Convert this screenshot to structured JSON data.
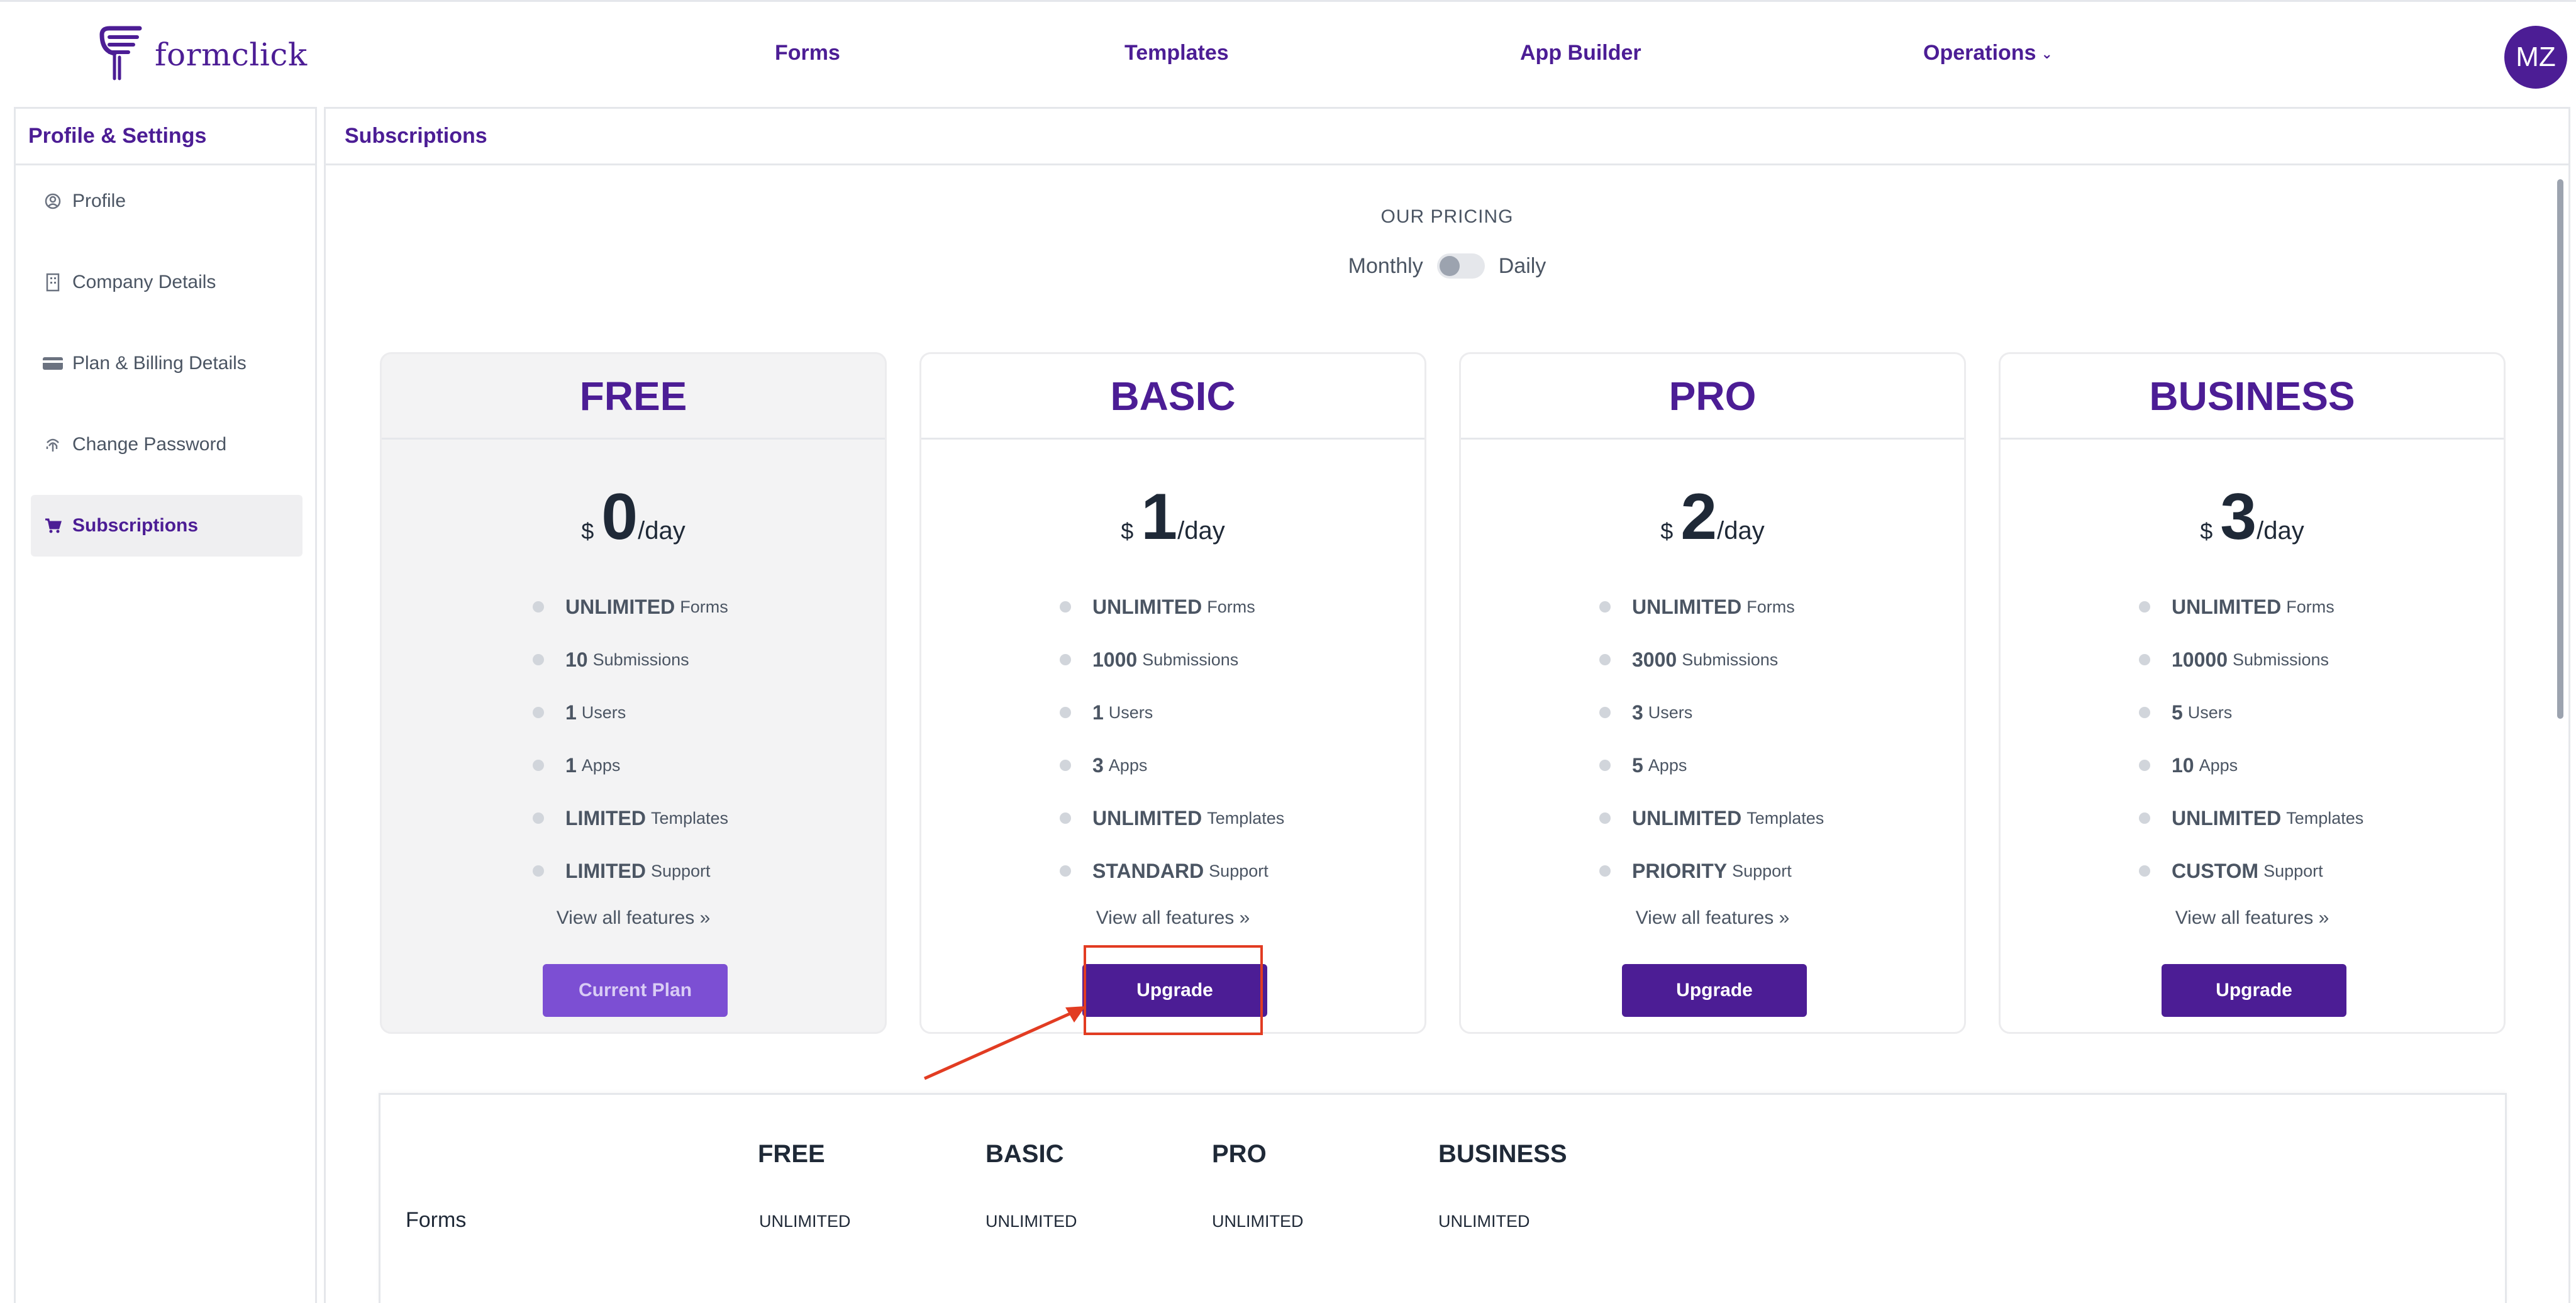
{
  "brand": {
    "name": "formclick"
  },
  "nav": {
    "items": [
      {
        "label": "Forms"
      },
      {
        "label": "Templates"
      },
      {
        "label": "App Builder"
      },
      {
        "label": "Operations"
      }
    ],
    "avatar_initials": "MZ"
  },
  "sidebar": {
    "title": "Profile & Settings",
    "items": [
      {
        "label": "Profile",
        "icon": "user-circle-icon"
      },
      {
        "label": "Company Details",
        "icon": "building-icon"
      },
      {
        "label": "Plan & Billing Details",
        "icon": "credit-card-icon"
      },
      {
        "label": "Change Password",
        "icon": "fingerprint-icon"
      },
      {
        "label": "Subscriptions",
        "icon": "cart-icon",
        "active": true
      }
    ]
  },
  "main": {
    "title": "Subscriptions",
    "pricing_title": "OUR PRICING",
    "toggle": {
      "left": "Monthly",
      "right": "Daily",
      "selected": "Daily"
    }
  },
  "plans": [
    {
      "name": "FREE",
      "currency": "$",
      "price": "0",
      "period": "/day",
      "features": [
        {
          "value": "UNLIMITED",
          "label": "Forms"
        },
        {
          "value": "10",
          "label": "Submissions"
        },
        {
          "value": "1",
          "label": "Users"
        },
        {
          "value": "1",
          "label": "Apps"
        },
        {
          "value": "LIMITED",
          "label": "Templates"
        },
        {
          "value": "LIMITED",
          "label": "Support"
        }
      ],
      "view_all": "View all features »",
      "button": "Current Plan"
    },
    {
      "name": "BASIC",
      "currency": "$",
      "price": "1",
      "period": "/day",
      "features": [
        {
          "value": "UNLIMITED",
          "label": "Forms"
        },
        {
          "value": "1000",
          "label": "Submissions"
        },
        {
          "value": "1",
          "label": "Users"
        },
        {
          "value": "3",
          "label": "Apps"
        },
        {
          "value": "UNLIMITED",
          "label": "Templates"
        },
        {
          "value": "STANDARD",
          "label": "Support"
        }
      ],
      "view_all": "View all features »",
      "button": "Upgrade"
    },
    {
      "name": "PRO",
      "currency": "$",
      "price": "2",
      "period": "/day",
      "features": [
        {
          "value": "UNLIMITED",
          "label": "Forms"
        },
        {
          "value": "3000",
          "label": "Submissions"
        },
        {
          "value": "3",
          "label": "Users"
        },
        {
          "value": "5",
          "label": "Apps"
        },
        {
          "value": "UNLIMITED",
          "label": "Templates"
        },
        {
          "value": "PRIORITY",
          "label": "Support"
        }
      ],
      "view_all": "View all features »",
      "button": "Upgrade"
    },
    {
      "name": "BUSINESS",
      "currency": "$",
      "price": "3",
      "period": "/day",
      "features": [
        {
          "value": "UNLIMITED",
          "label": "Forms"
        },
        {
          "value": "10000",
          "label": "Submissions"
        },
        {
          "value": "5",
          "label": "Users"
        },
        {
          "value": "10",
          "label": "Apps"
        },
        {
          "value": "UNLIMITED",
          "label": "Templates"
        },
        {
          "value": "CUSTOM",
          "label": "Support"
        }
      ],
      "view_all": "View all features »",
      "button": "Upgrade"
    }
  ],
  "comparison": {
    "columns": [
      "FREE",
      "BASIC",
      "PRO",
      "BUSINESS"
    ],
    "rows": [
      {
        "label": "Forms",
        "values": [
          "UNLIMITED",
          "UNLIMITED",
          "UNLIMITED",
          "UNLIMITED"
        ]
      }
    ]
  },
  "annotation": {
    "color": "#e23c22"
  },
  "colors": {
    "brand": "#4c1d95",
    "current_plan_button": "#7c4fd3"
  }
}
